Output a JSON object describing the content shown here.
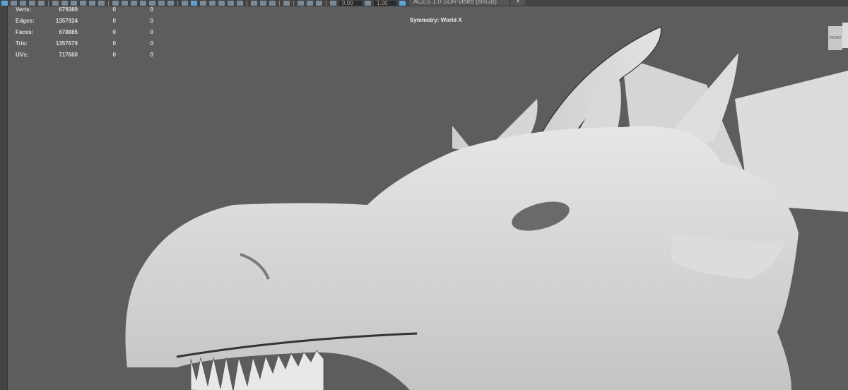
{
  "toolbar": {
    "exposure_value": "0.00",
    "gamma_value": "1.00",
    "color_space": "ACES 1.0 SDR-video (sRGB)"
  },
  "hud": {
    "rows": [
      {
        "label": "Verts:",
        "value": "679389",
        "col2": "0",
        "col3": "0"
      },
      {
        "label": "Edges:",
        "value": "1357924",
        "col2": "0",
        "col3": "0"
      },
      {
        "label": "Faces:",
        "value": "678885",
        "col2": "0",
        "col3": "0"
      },
      {
        "label": "Tris:",
        "value": "1357679",
        "col2": "0",
        "col3": "0"
      },
      {
        "label": "UVs:",
        "value": "717660",
        "col2": "0",
        "col3": "0"
      }
    ],
    "symmetry": "Symmetry: World X"
  },
  "viewcube": {
    "face": "FRONT"
  },
  "colors": {
    "viewport_bg": "#5d5d5d",
    "model": "#d8d8d8",
    "accent": "#5aa5d6"
  }
}
